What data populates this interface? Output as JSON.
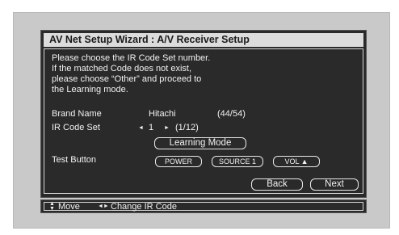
{
  "dialog": {
    "title": "AV Net Setup Wizard : A/V Receiver Setup",
    "instructions": [
      "Please choose the IR Code Set number.",
      "If the matched Code does not exist,",
      "please choose “Other” and proceed to",
      "the Learning mode."
    ],
    "brand": {
      "label": "Brand Name",
      "value": "Hitachi",
      "position": "(44/54)"
    },
    "ir_code": {
      "label": "IR Code Set",
      "value": "1",
      "position": "(1/12)",
      "left_arrow": "◄",
      "right_arrow": "►"
    },
    "learning_mode_label": "Learning Mode",
    "test": {
      "label": "Test Button",
      "buttons": [
        "POWER",
        "SOURCE 1",
        "VOL ▲"
      ]
    },
    "back_label": "Back",
    "next_label": "Next"
  },
  "statusbar": {
    "move_icon": "up-down-arrows-icon",
    "move_label": "Move",
    "change_icon": "left-right-arrows-icon",
    "change_label": "Change IR Code"
  }
}
